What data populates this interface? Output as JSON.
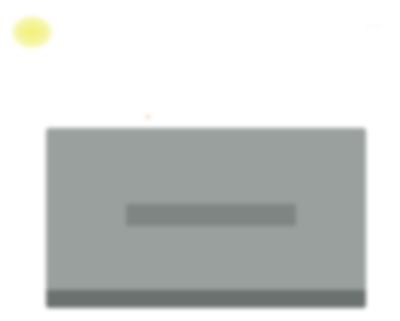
{
  "post": {
    "author": "",
    "meta": "",
    "menu_icon": "more-dots-icon",
    "text_line_1": "",
    "text_line_2": "",
    "reaction_icon": "emoji-reaction-icon"
  },
  "media": {
    "title": "",
    "background_color": "#9aa09d",
    "bar_color": "#6b716e"
  },
  "colors": {
    "avatar": "#f2f074",
    "text": "#cfcfcf"
  }
}
